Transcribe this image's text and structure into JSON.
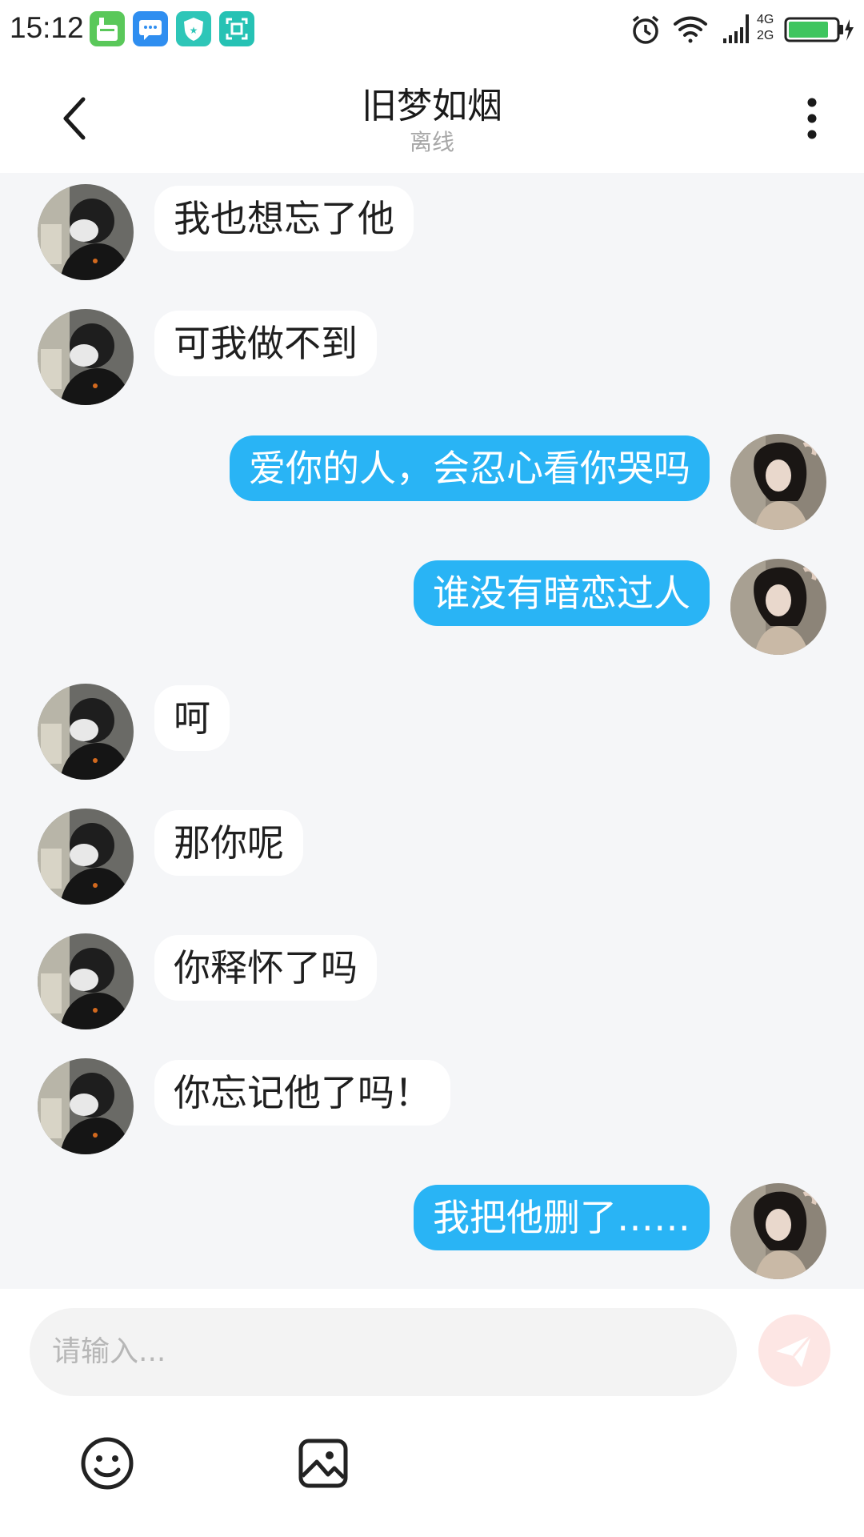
{
  "status_bar": {
    "time": "15:12",
    "network_top": "4G",
    "network_bottom": "2G",
    "icons": [
      "cleaner-app-icon",
      "message-app-icon",
      "shield-app-icon",
      "scan-app-icon",
      "alarm-icon",
      "wifi-icon",
      "signal-icon",
      "battery-icon"
    ],
    "battery_level": 0.85
  },
  "header": {
    "title": "旧梦如烟",
    "status": "离线",
    "back_icon": "chevron-left-icon",
    "more_icon": "more-vertical-icon"
  },
  "messages": [
    {
      "from": "other",
      "text": "我也想忘了他"
    },
    {
      "from": "other",
      "text": "可我做不到"
    },
    {
      "from": "me",
      "text": "爱你的人，会忍心看你哭吗"
    },
    {
      "from": "me",
      "text": "谁没有暗恋过人"
    },
    {
      "from": "other",
      "text": "呵"
    },
    {
      "from": "other",
      "text": "那你呢"
    },
    {
      "from": "other",
      "text": "你释怀了吗"
    },
    {
      "from": "other",
      "text": "你忘记他了吗！"
    },
    {
      "from": "me",
      "text": "我把他删了……"
    }
  ],
  "composer": {
    "placeholder": "请输入...",
    "send_icon": "send-icon",
    "tools": [
      "emoji-icon",
      "image-icon"
    ]
  },
  "colors": {
    "outgoing_bubble": "#29b4f5",
    "incoming_bubble": "#ffffff",
    "chat_background": "#f5f6f8",
    "send_button": "#fde6e4"
  }
}
